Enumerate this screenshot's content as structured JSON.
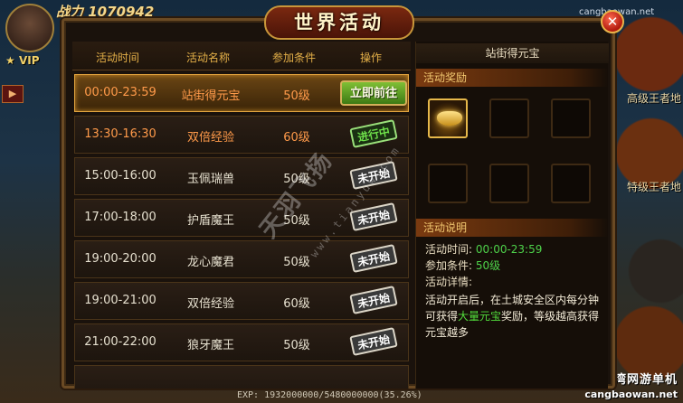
{
  "hud": {
    "power_label": "战力",
    "power_value": "1070942",
    "vip": "VIP",
    "side_labels": [
      "高级王者地",
      "特级王者地"
    ],
    "exp_text": "EXP: 1932000000/5480000000(35.26%)",
    "watermark_site": "藏宝湾网游单机",
    "watermark_url": "cangbaowan.net",
    "watermark_top": "cangbaowan.net"
  },
  "panel": {
    "title": "世界活动",
    "close_symbol": "✕"
  },
  "list": {
    "headers": [
      "活动时间",
      "活动名称",
      "参加条件",
      "操作"
    ],
    "rows": [
      {
        "time": "00:00-23:59",
        "name": "站街得元宝",
        "cond": "50级",
        "action": "立即前往",
        "state": "active"
      },
      {
        "time": "13:30-16:30",
        "name": "双倍经验",
        "cond": "60级",
        "action": "进行中",
        "state": "ongoing"
      },
      {
        "time": "15:00-16:00",
        "name": "玉佩瑞兽",
        "cond": "50级",
        "action": "未开始",
        "state": "pending"
      },
      {
        "time": "17:00-18:00",
        "name": "护盾魔王",
        "cond": "50级",
        "action": "未开始",
        "state": "pending"
      },
      {
        "time": "19:00-20:00",
        "name": "龙心魔君",
        "cond": "50级",
        "action": "未开始",
        "state": "pending"
      },
      {
        "time": "19:00-21:00",
        "name": "双倍经验",
        "cond": "60级",
        "action": "未开始",
        "state": "pending"
      },
      {
        "time": "21:00-22:00",
        "name": "狼牙魔王",
        "cond": "50级",
        "action": "未开始",
        "state": "pending"
      }
    ],
    "overlay_watermark": "天羽飞扬",
    "overlay_watermark_url": "www.tianyuw.com"
  },
  "detail": {
    "title": "站街得元宝",
    "reward_section": "活动奖励",
    "info_section": "活动说明",
    "time_label": "活动时间:",
    "time_value": "00:00-23:59",
    "cond_label": "参加条件:",
    "cond_value": "50级",
    "detail_label": "活动详情:",
    "desc_part1": "活动开启后，在土城安全区内每分钟可获得",
    "desc_highlight": "大量元宝",
    "desc_part2": "奖励，等级越高获得元宝越多"
  }
}
